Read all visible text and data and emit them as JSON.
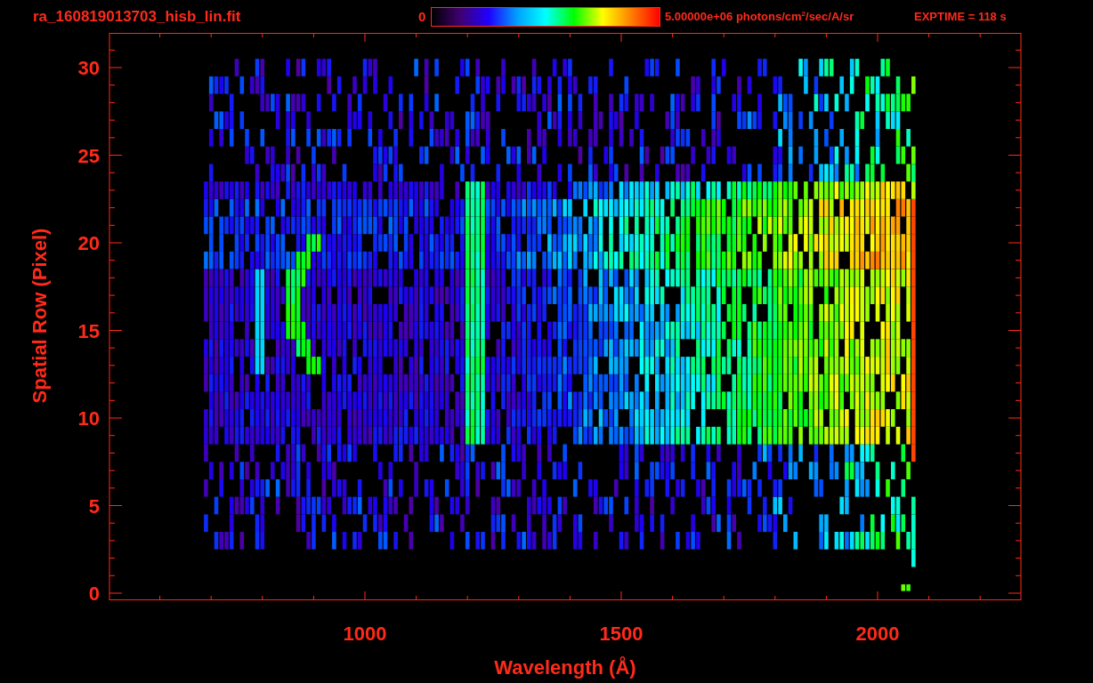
{
  "title": "ra_160819013703_hisb_lin.fit",
  "colorbar": {
    "min_label": "0",
    "max_label": "5.00000e+06 photons/cm$^{2}$/sec/A/sr"
  },
  "exposure": "EXPTIME = 118 s",
  "plot": {
    "y_axis": {
      "title": "Spatial Row (Pixel)",
      "ticks": [
        "30",
        "25",
        "20",
        "15",
        "10",
        "5",
        "0"
      ]
    },
    "x_axis": {
      "title": "Wavelength (Å)",
      "ticks": [
        "1000",
        "1500",
        "2000"
      ]
    }
  }
}
